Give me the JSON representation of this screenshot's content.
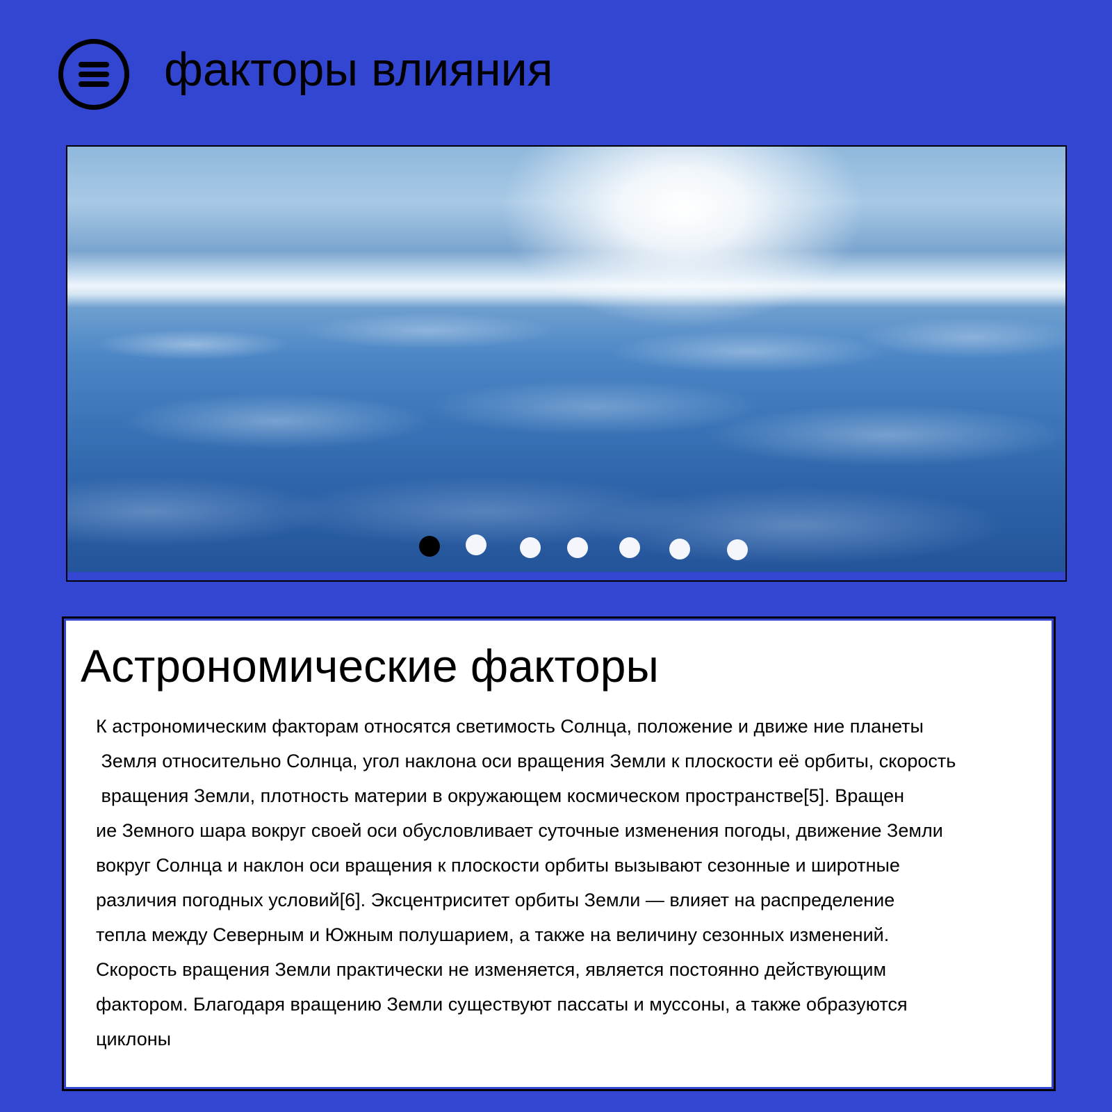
{
  "header": {
    "menu_icon": "hamburger-circle-icon",
    "title": "факторы влияния"
  },
  "slider": {
    "image": "clouds-above-horizon-photo",
    "total_slides": 7,
    "active_slide": 1,
    "colors": {
      "active_dot": "#000000",
      "inactive_dot": "#f4f6fb"
    }
  },
  "content": {
    "heading": "Астрономические факторы",
    "lines": [
      "К астрономическим факторам относятся светимость Солнца, положение и движе ние планеты",
      " Земля относительно Солнца, угол наклона оси вращения Земли к плоскости её орбиты, скорость",
      " вращения Земли, плотность материи в окружающем космическом пространстве[5]. Вращен",
      "ие Земного шара вокруг своей оси обусловливает суточные изменения погоды, движение Земли",
      "вокруг Солнца и наклон оси вращения к плоскости орбиты вызывают сезонные и широтные",
      "различия погодных условий[6]. Эксцентриситет орбиты Земли — влияет на распределение",
      "тепла между Северным и Южным полушарием, а также на величину сезонных изменений.",
      "Скорость вращения Земли практически не изменяется, является постоянно действующим",
      "фактором. Благодаря вращению Земли существуют пассаты и муссоны, а также образуются",
      "циклоны"
    ]
  },
  "colors": {
    "page_background": "#3346d1",
    "card_background": "#ffffff",
    "text": "#000000"
  }
}
